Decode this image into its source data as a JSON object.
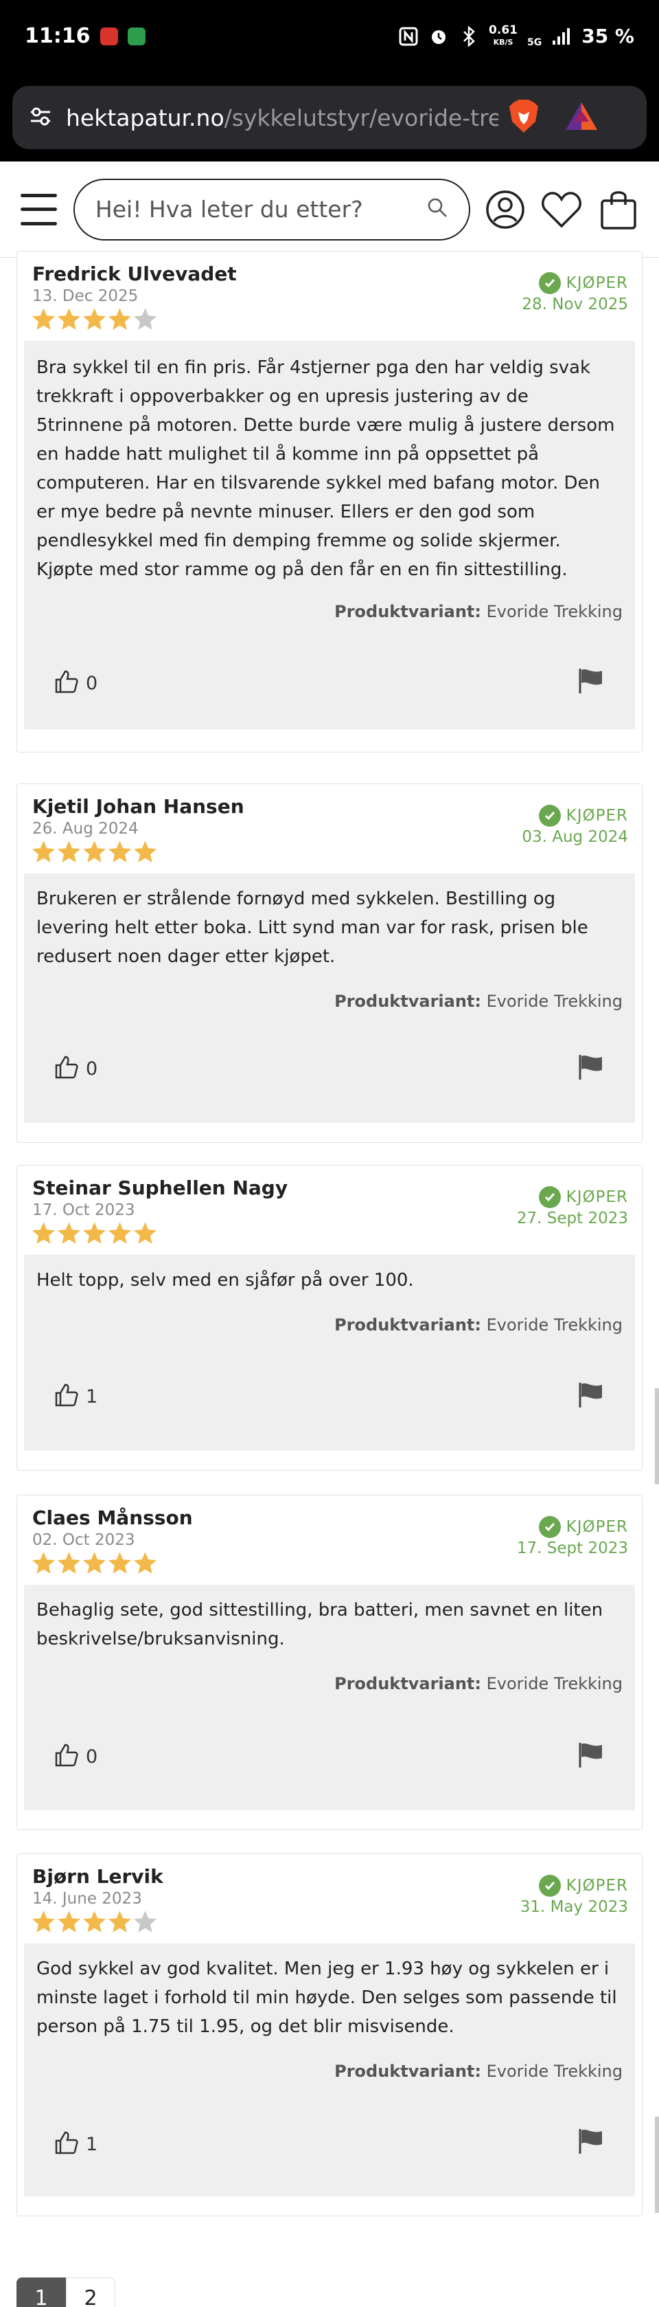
{
  "status_bar": {
    "time": "11:16",
    "speed_value": "0.61",
    "speed_unit": "KB/S",
    "network": "5G",
    "battery": "35 %"
  },
  "browser": {
    "url_host": "hektapatur.no",
    "url_path": "/sykkelutstyr/evoride-trekkin"
  },
  "header": {
    "search_placeholder": "Hei! Hva leter du etter?"
  },
  "buyer_label": "KJØPER",
  "variant_label": "Produktvariant:",
  "reviews": [
    {
      "name": "Fredrick Ulvevadet",
      "date": "13. Dec 2025",
      "rating": 4,
      "purchase_date": "28. Nov 2025",
      "text_lines": [
        "Bra sykkel til en fin pris. Får 4stjerner pga den har veldig svak",
        "trekkraft i oppoverbakker og en upresis justering av de",
        "5trinnene på motoren. Dette burde være mulig å justere dersom",
        "en hadde hatt mulighet til å komme inn på oppsettet på",
        "computeren. Har en tilsvarende sykkel med bafang motor. Den",
        "er mye bedre på nevnte minuser. Ellers er den god som",
        "pendlesykkel med fin demping fremme og solide skjermer.",
        "Kjøpte med stor ramme og på den får en en fin sittestilling."
      ],
      "variant": "Evoride Trekking",
      "likes": "0"
    },
    {
      "name": "Kjetil Johan Hansen",
      "date": "26. Aug 2024",
      "rating": 5,
      "purchase_date": "03. Aug 2024",
      "text_lines": [
        "Brukeren er strålende fornøyd med sykkelen. Bestilling og",
        "levering helt etter boka.  Litt synd man var for rask, prisen ble",
        "redusert noen dager etter kjøpet."
      ],
      "variant": "Evoride Trekking",
      "likes": "0"
    },
    {
      "name": "Steinar Suphellen Nagy",
      "date": "17. Oct 2023",
      "rating": 5,
      "purchase_date": "27. Sept 2023",
      "text_lines": [
        "Helt topp, selv med en sjåfør på over 100."
      ],
      "variant": "Evoride Trekking",
      "likes": "1"
    },
    {
      "name": "Claes Månsson",
      "date": "02. Oct 2023",
      "rating": 5,
      "purchase_date": "17. Sept 2023",
      "text_lines": [
        "Behaglig sete, god sittestilling, bra batteri, men savnet en liten",
        "beskrivelse/bruksanvisning."
      ],
      "variant": "Evoride Trekking",
      "likes": "0"
    },
    {
      "name": "Bjørn Lervik",
      "date": "14. June 2023",
      "rating": 4,
      "purchase_date": "31. May 2023",
      "text_lines": [
        "God sykkel av god kvalitet. Men jeg er 1.93 høy og sykkelen er i",
        "minste laget i forhold til min høyde. Den selges som passende til",
        "person på 1.75 til 1.95, og det blir misvisende."
      ],
      "variant": "Evoride Trekking",
      "likes": "1"
    }
  ],
  "pagination": {
    "pages": [
      "1",
      "2"
    ],
    "current": "1"
  },
  "colors": {
    "star_filled": "#f2b94a",
    "star_empty": "#c8c8c8",
    "buyer_green": "#6aa84f",
    "review_box": "#efefef"
  }
}
